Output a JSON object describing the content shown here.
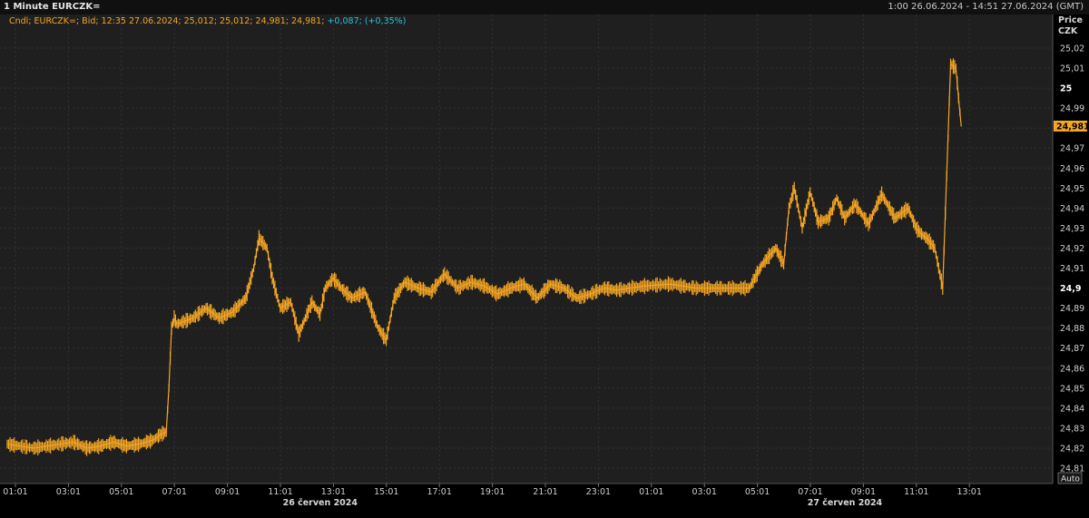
{
  "header": {
    "title": "1 Minute EURCZK=",
    "date_range": "1:00 26.06.2024 - 14:51 27.06.2024 (GMT)"
  },
  "legend": {
    "text": "Cndl; EURCZK=; Bid; 12:35 27.06.2024; 25,012; 25,012; 24,981; 24,981;",
    "change": "+0,087; (+0,35%)"
  },
  "axis": {
    "price_label": "Price",
    "currency": "CZK",
    "auto_button": "Auto",
    "last_price": "24,981",
    "y_ticks": [
      "25,02",
      "25,01",
      "25",
      "24,99",
      "24,98",
      "24,97",
      "24,96",
      "24,95",
      "24,94",
      "24,93",
      "24,92",
      "24,91",
      "24,9",
      "24,89",
      "24,88",
      "24,87",
      "24,86",
      "24,85",
      "24,84",
      "24,83",
      "24,82",
      "24,81"
    ],
    "y_tick_bold": [
      "25",
      "24,9"
    ],
    "x_ticks": [
      "01:01",
      "03:01",
      "05:01",
      "07:01",
      "09:01",
      "11:01",
      "13:01",
      "15:01",
      "17:01",
      "19:01",
      "21:01",
      "23:01",
      "01:01",
      "03:01",
      "05:01",
      "07:01",
      "09:01",
      "11:01",
      "13:01"
    ],
    "date_labels": [
      "26 červen 2024",
      "27 červen 2024"
    ]
  },
  "colors": {
    "line": "#f5a623",
    "background": "#1f1f1f",
    "grid": "#333333",
    "change": "#29c5d6",
    "last_price_box": "#f5a623"
  },
  "chart_data": {
    "type": "line",
    "title": "1 Minute EURCZK=",
    "ylabel": "Price CZK",
    "ylim": [
      24.81,
      25.025
    ],
    "x_unit": "hours since 01:01 26.06.2024",
    "series": [
      {
        "name": "EURCZK= Bid",
        "x": [
          0,
          1,
          2,
          2.5,
          3,
          3.5,
          4,
          4.5,
          5,
          5.5,
          5.8,
          6,
          6.1,
          6.2,
          6.3,
          6.4,
          6.6,
          7,
          7.5,
          8,
          8.5,
          9,
          9.3,
          9.5,
          9.8,
          10,
          10.3,
          10.7,
          11,
          11.5,
          11.8,
          12,
          12.3,
          12.6,
          13,
          13.5,
          14,
          14.3,
          14.6,
          15,
          15.5,
          16,
          16.5,
          17,
          17.5,
          18,
          18.5,
          19,
          19.5,
          20,
          20.5,
          21,
          21.5,
          22,
          22.5,
          23,
          24,
          25,
          26,
          27,
          28,
          28.5,
          29,
          29.3,
          29.5,
          29.7,
          30,
          30.3,
          30.6,
          31,
          31.3,
          31.6,
          32,
          32.5,
          33,
          33.5,
          34,
          34.3,
          34.5,
          34.7,
          35,
          35.3,
          35.6,
          35.8,
          35.9,
          36
        ],
        "values": [
          24.822,
          24.82,
          24.822,
          24.823,
          24.82,
          24.821,
          24.823,
          24.821,
          24.822,
          24.824,
          24.827,
          24.828,
          24.85,
          24.88,
          24.885,
          24.882,
          24.883,
          24.885,
          24.89,
          24.885,
          24.888,
          24.895,
          24.91,
          24.925,
          24.92,
          24.905,
          24.89,
          24.893,
          24.877,
          24.893,
          24.887,
          24.9,
          24.905,
          24.9,
          24.895,
          24.898,
          24.88,
          24.874,
          24.895,
          24.903,
          24.9,
          24.898,
          24.907,
          24.9,
          24.903,
          24.901,
          24.897,
          24.9,
          24.902,
          24.895,
          24.902,
          24.9,
          24.895,
          24.897,
          24.9,
          24.899,
          24.901,
          24.902,
          24.9,
          24.9,
          24.9,
          24.912,
          24.92,
          24.912,
          24.94,
          24.95,
          24.93,
          24.948,
          24.933,
          24.935,
          24.945,
          24.935,
          24.942,
          24.932,
          24.947,
          24.935,
          24.94,
          24.93,
          24.927,
          24.925,
          24.92,
          24.9,
          25.012,
          25.01,
          24.995,
          24.981
        ]
      }
    ]
  }
}
